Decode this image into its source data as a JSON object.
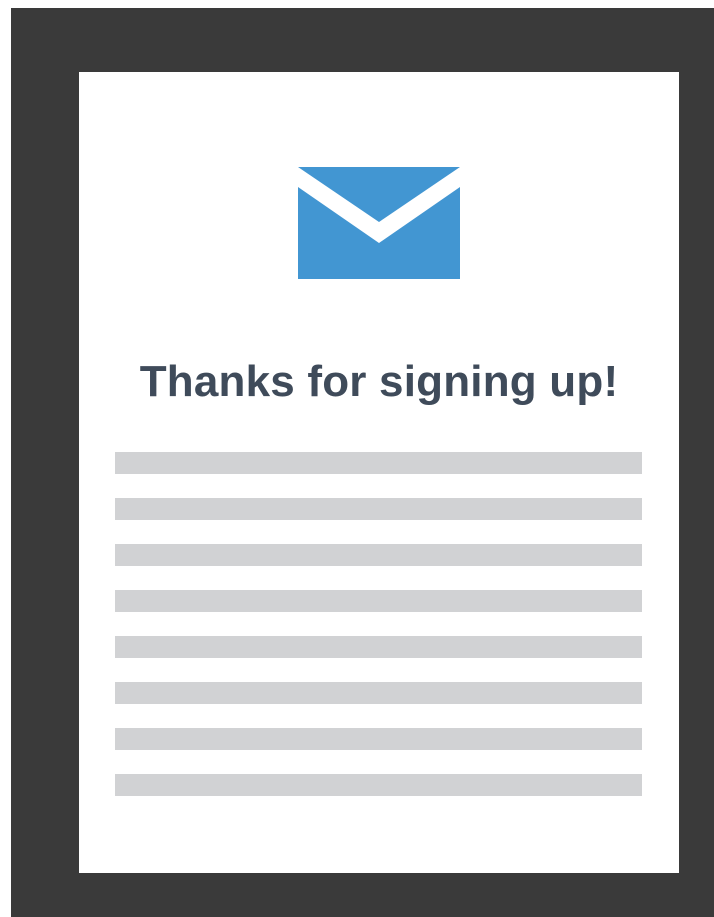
{
  "heading": "Thanks for signing up!",
  "icon": {
    "name": "envelope-icon",
    "color": "#4296d2"
  },
  "colors": {
    "frame": "#3a3a3a",
    "card": "#ffffff",
    "heading": "#3f4b5a",
    "placeholder_line": "#d1d2d4"
  },
  "placeholder_line_count": 8
}
